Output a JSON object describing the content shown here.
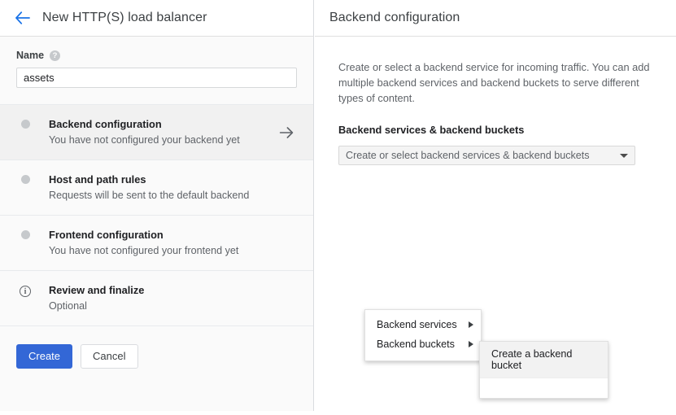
{
  "window": {
    "back_icon": "arrow-left-icon",
    "title": "New HTTP(S) load balancer"
  },
  "name_field": {
    "label": "Name",
    "help_icon": "help-icon",
    "value": "assets",
    "placeholder": ""
  },
  "steps": [
    {
      "icon": "step-dot-icon",
      "title": "Backend configuration",
      "subtitle": "You have not configured your backend yet",
      "selected": true,
      "chevron": "arrow-right-icon"
    },
    {
      "icon": "step-dot-icon",
      "title": "Host and path rules",
      "subtitle": "Requests will be sent to the default backend",
      "selected": false,
      "chevron": ""
    },
    {
      "icon": "step-dot-icon",
      "title": "Frontend configuration",
      "subtitle": "You have not configured your frontend yet",
      "selected": false,
      "chevron": ""
    },
    {
      "icon": "info-icon",
      "title": "Review and finalize",
      "subtitle": "Optional",
      "selected": false,
      "chevron": ""
    }
  ],
  "footer": {
    "create_label": "Create",
    "cancel_label": "Cancel"
  },
  "detail": {
    "title": "Backend configuration",
    "description": "Create or select a backend service for incoming traffic. You can add multiple backend services and backend buckets to serve different types of content.",
    "section_heading": "Backend services & backend buckets",
    "select": {
      "value": "Create or select backend services & backend buckets",
      "caret_icon": "chevron-down-icon"
    },
    "menu": {
      "items": [
        {
          "label": "Backend services",
          "arrow_icon": "chevron-right-icon"
        },
        {
          "label": "Backend buckets",
          "arrow_icon": "chevron-right-icon"
        }
      ],
      "submenu": {
        "items": [
          {
            "label": "Create a backend bucket"
          }
        ]
      }
    }
  },
  "colors": {
    "accent": "#3367d6",
    "link": "#1a73e8",
    "panel_bg": "#fafafa",
    "selected_row": "#f1f1f1",
    "muted_text": "#5f6368"
  }
}
